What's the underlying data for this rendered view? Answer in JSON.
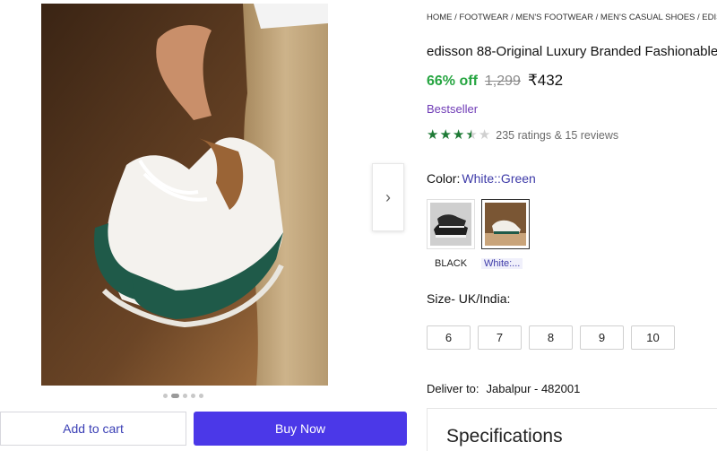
{
  "gallery": {
    "next_icon": "chevron-right-icon",
    "dot_count": 5,
    "active_dot": 1
  },
  "actions": {
    "add_to_cart": "Add to cart",
    "buy_now": "Buy Now"
  },
  "breadcrumb": "HOME / FOOTWEAR / MEN'S FOOTWEAR / MEN'S CASUAL SHOES / EDISSON",
  "product": {
    "title": "edisson 88-Original Luxury Branded Fashionable",
    "discount": "66% off",
    "mrp": "1,299",
    "price": "₹432",
    "badge": "Bestseller",
    "rating": 3.5,
    "rating_text": "235 ratings  & 15 reviews"
  },
  "color": {
    "label": "Color:",
    "selected": "White::Green",
    "options": [
      {
        "name": "BLACK"
      },
      {
        "name": "White:..."
      }
    ]
  },
  "size": {
    "label": "Size- UK/India:",
    "options": [
      "6",
      "7",
      "8",
      "9",
      "10"
    ]
  },
  "delivery": {
    "label": "Deliver to:",
    "location": "Jabalpur - 482001"
  },
  "specifications": {
    "title": "Specifications"
  },
  "colors": {
    "accent": "#4b38e8",
    "discount_green": "#26a541",
    "star_green": "#1e7a35",
    "bestseller_purple": "#6f3bb6"
  }
}
